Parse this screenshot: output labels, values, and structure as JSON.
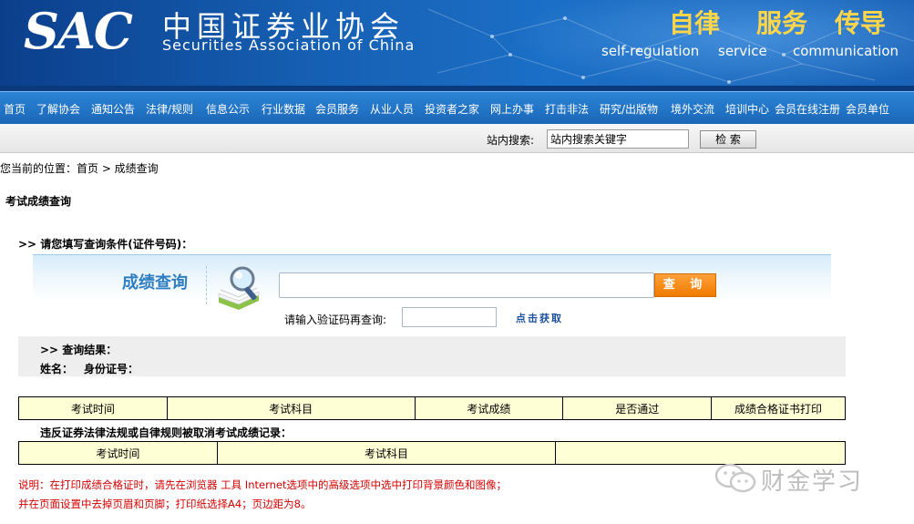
{
  "header": {
    "logo": "SAC",
    "org_name_cn": "中国证券业协会",
    "org_name_en": "Securities Association of China",
    "slogans": [
      {
        "cn": "自律",
        "en": "self-regulation"
      },
      {
        "cn": "服务",
        "en": "service"
      },
      {
        "cn": "传导",
        "en": "communication"
      }
    ]
  },
  "nav": {
    "items": [
      "首页",
      "了解协会",
      "通知公告",
      "法律/规则",
      "信息公示",
      "行业数据",
      "会员服务",
      "从业人员",
      "投资者之家",
      "网上办事",
      "打击非法",
      "研究/出版物",
      "境外交流",
      "培训中心",
      "会员在线注册",
      "会员单位"
    ]
  },
  "search": {
    "label": "站内搜索:",
    "value": "站内搜索关键字",
    "button": "检 索"
  },
  "breadcrumb": "您当前的位置：首页 > 成绩查询",
  "page_title": "考试成绩查询",
  "prompt": ">> 请您填写查询条件(证件号码)：",
  "query_panel": {
    "title": "成绩查询",
    "input_value": "",
    "button": "查 询",
    "captcha_label": "请输入验证码再查询:",
    "captcha_link": "点击获取"
  },
  "results": {
    "title": ">> 查询结果：",
    "name_label": "姓名：",
    "id_label": "身份证号："
  },
  "score_table": {
    "headers": [
      "考试时间",
      "考试科目",
      "考试成绩",
      "是否通过",
      "成绩合格证书打印"
    ]
  },
  "violation": {
    "title": "违反证券法律法规或自律规则被取消考试成绩记录：",
    "headers": [
      "考试时间",
      "考试科目",
      ""
    ]
  },
  "notes": [
    "说明：在打印成绩合格证时，请先在浏览器 工具 Internet选项中的高级选项中选中打印背景颜色和图像；",
    "并在页面设置中去掉页眉和页脚；打印纸选择A4；页边距为8。"
  ],
  "watermark": "财金学习",
  "colors": {
    "banner": "#1660b4",
    "nav": "#2577c8",
    "slogan": "#ffd64a",
    "panel_title": "#2f7ec2",
    "query_button": "#f58a10",
    "table_bg": "#ffffd6",
    "note": "#d40000"
  }
}
